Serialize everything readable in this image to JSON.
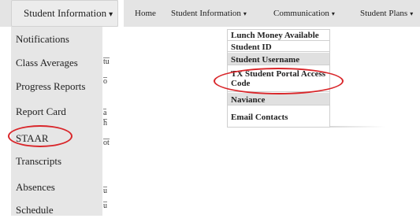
{
  "left": {
    "menu_title": "Student Information",
    "caret": "▾",
    "items": [
      "Notifications",
      "Class Averages",
      "Progress Reports",
      "Report Card",
      "STAAR",
      "Transcripts",
      "Absences",
      "Schedule"
    ],
    "background_fragments": [
      "tu",
      "o",
      "a",
      "h",
      "ot",
      "u",
      "u"
    ],
    "highlight_color": "#d9262a"
  },
  "right": {
    "nav": [
      "Home",
      "Student Information",
      "Communication",
      "Student Plans"
    ],
    "caret": "▾",
    "dropdown_items": [
      "Lunch Money Available",
      "Student ID",
      "Student Username",
      "TX Student Portal Access Code",
      "Naviance",
      "Email Contacts"
    ],
    "highlight_color": "#d9262a"
  }
}
